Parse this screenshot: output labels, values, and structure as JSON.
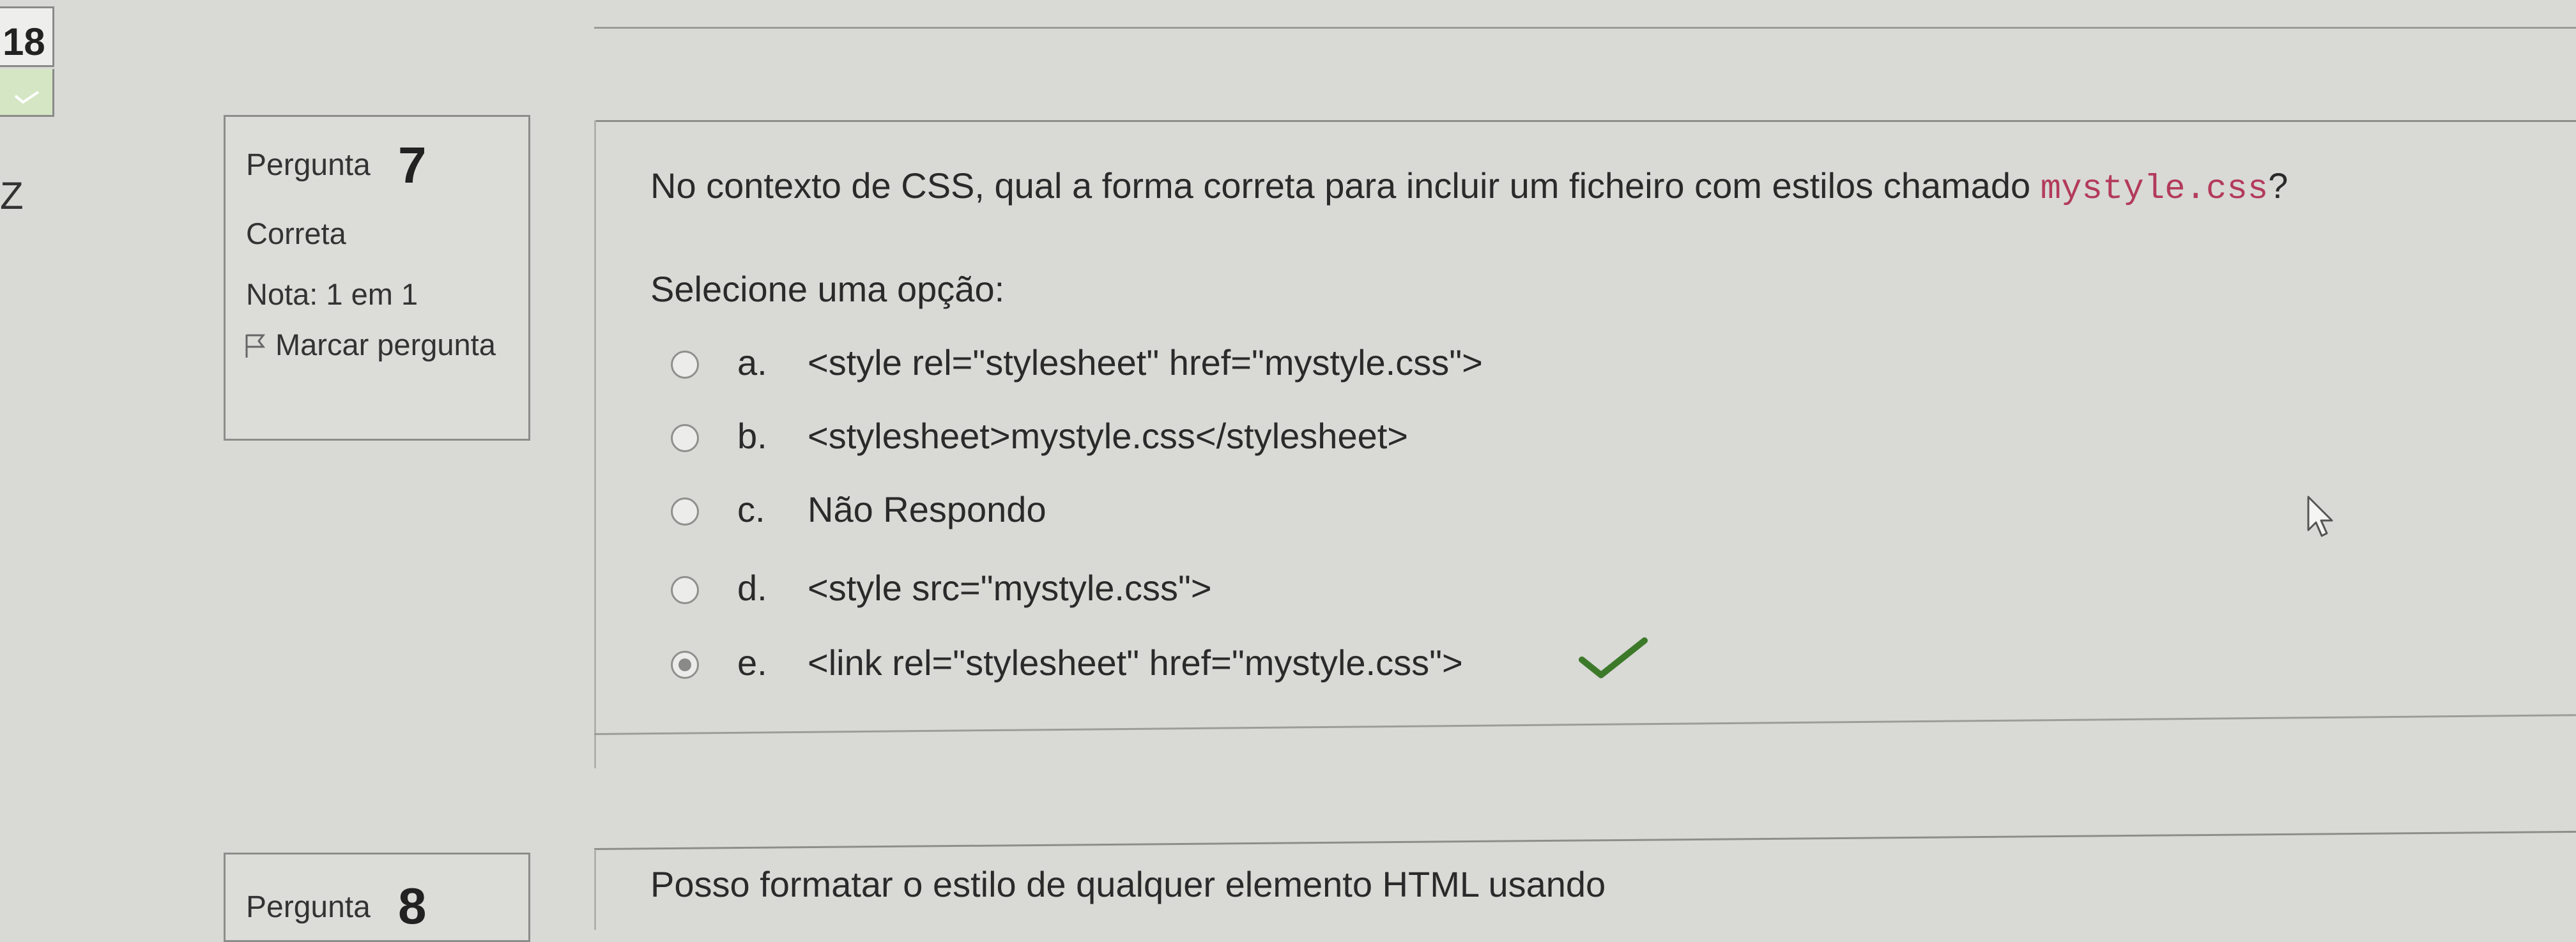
{
  "nav": {
    "question_number": "18",
    "edge_letter": "Z"
  },
  "question7": {
    "label": "Pergunta",
    "number": "7",
    "state": "Correta",
    "grade": "Nota: 1 em 1",
    "flag_label": "Marcar pergunta",
    "text_before": "No contexto de CSS, qual a forma correta para incluir um ficheiro com estilos chamado ",
    "text_code": "mystyle.css",
    "text_after": "?",
    "prompt": "Selecione uma opção:",
    "options": [
      {
        "letter": "a.",
        "text": "<style rel=\"stylesheet\" href=\"mystyle.css\">",
        "selected": false
      },
      {
        "letter": "b.",
        "text": "<stylesheet>mystyle.css</stylesheet>",
        "selected": false
      },
      {
        "letter": "c.",
        "text": "Não Respondo",
        "selected": false
      },
      {
        "letter": "d.",
        "text": "<style src=\"mystyle.css\">",
        "selected": false
      },
      {
        "letter": "e.",
        "text": "<link rel=\"stylesheet\" href=\"mystyle.css\">",
        "selected": true,
        "correct": true
      }
    ]
  },
  "question8": {
    "label": "Pergunta",
    "number": "8",
    "text": "Posso formatar o estilo de qualquer elemento HTML usando"
  },
  "colors": {
    "code": "#b33a5a",
    "correct_check": "#3c7a2a",
    "nav_answered": "#d4e6c4"
  },
  "icons": {
    "nav_check": "check-icon",
    "flag": "flag-icon",
    "correct": "check-icon",
    "cursor": "mouse-pointer-icon"
  }
}
